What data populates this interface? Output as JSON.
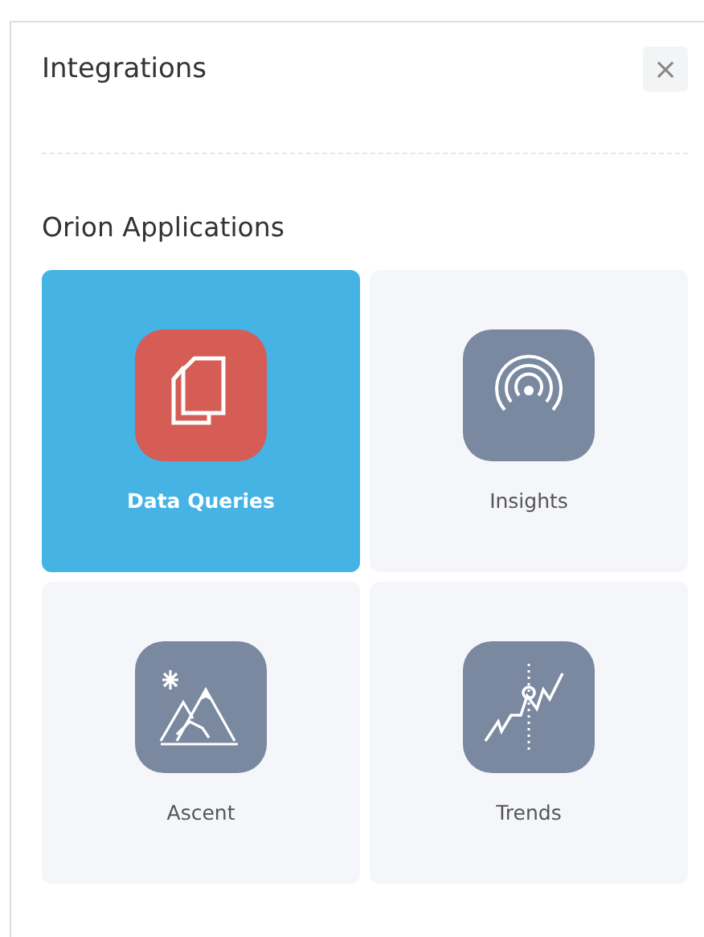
{
  "window": {
    "title": "Integrations",
    "close": "×"
  },
  "section": {
    "title": "Orion Applications"
  },
  "apps": [
    {
      "label": "Data Queries",
      "selected": true,
      "kind": "documents",
      "color": "#d65d55"
    },
    {
      "label": "Insights",
      "selected": false,
      "kind": "signal",
      "color": "#7a88a0"
    },
    {
      "label": "Ascent",
      "selected": false,
      "kind": "mountains",
      "color": "#7a88a0"
    },
    {
      "label": "Trends",
      "selected": false,
      "kind": "trends",
      "color": "#7a88a0"
    }
  ]
}
